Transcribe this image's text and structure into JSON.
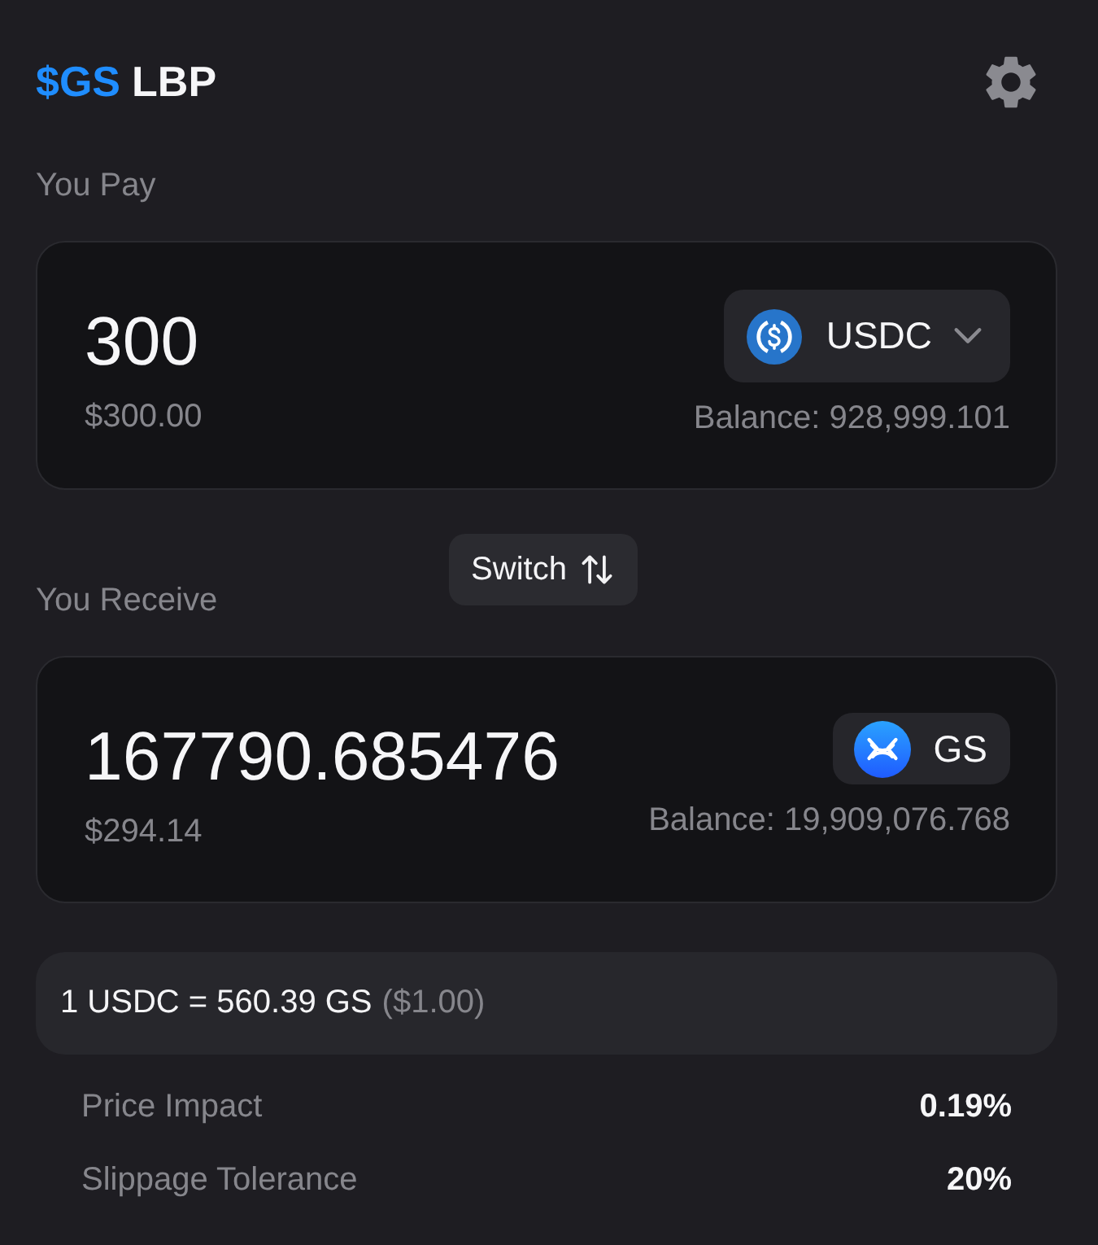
{
  "header": {
    "title_accent": "$GS",
    "title": "LBP"
  },
  "pay": {
    "label": "You Pay",
    "amount": "300",
    "amount_usd": "$300.00",
    "token": {
      "symbol": "USDC",
      "kind": "usdc",
      "dropdown": true
    },
    "balance": "Balance: 928,999.101"
  },
  "switch_button": {
    "label": "Switch"
  },
  "receive": {
    "label": "You Receive",
    "amount": "167790.685476",
    "amount_usd": "$294.14",
    "token": {
      "symbol": "GS",
      "kind": "gs",
      "dropdown": false
    },
    "balance": "Balance: 19,909,076.768"
  },
  "rate": {
    "text": "1 USDC = 560.39 GS",
    "usd": "($1.00)"
  },
  "details": [
    {
      "label": "Price Impact",
      "value": "0.19%"
    },
    {
      "label": "Slippage Tolerance",
      "value": "20%"
    }
  ]
}
